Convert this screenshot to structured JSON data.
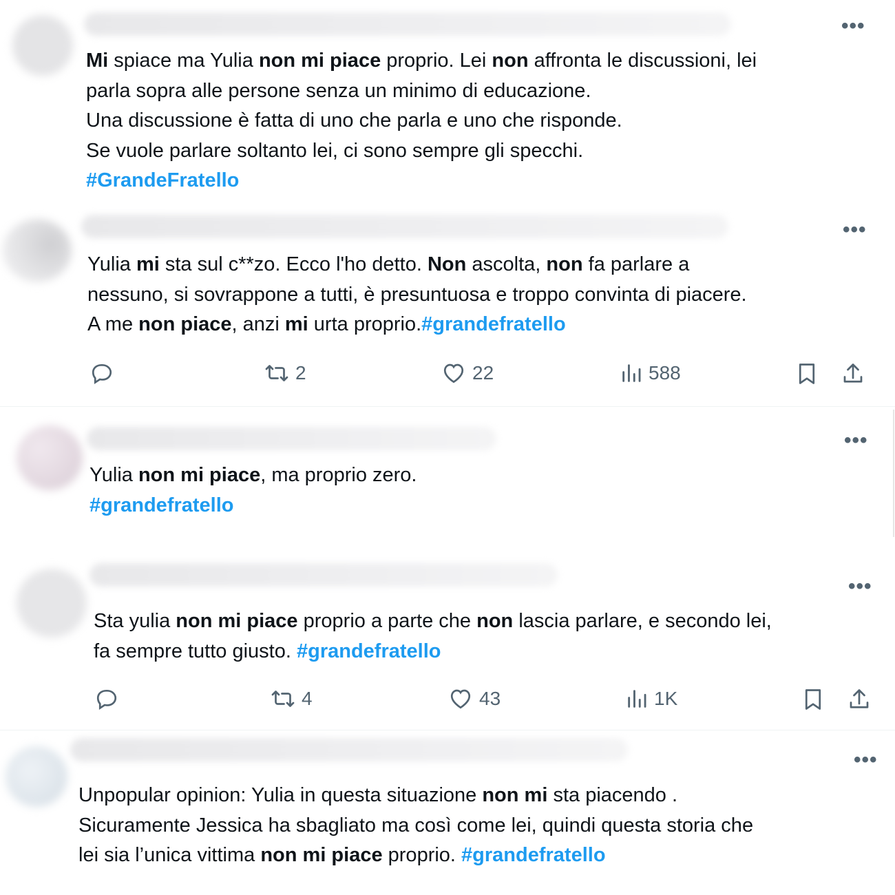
{
  "tweets": [
    {
      "segments": [
        {
          "t": "Mi",
          "s": "b"
        },
        {
          "t": " spiace ma Yulia ",
          "s": ""
        },
        {
          "t": "non mi piace",
          "s": "b"
        },
        {
          "t": " proprio. Lei ",
          "s": ""
        },
        {
          "t": "non",
          "s": "b"
        },
        {
          "t": " affronta le discussioni, lei",
          "s": ""
        },
        {
          "t": "\n",
          "s": "br"
        },
        {
          "t": "parla sopra alle persone senza un minimo di educazione.",
          "s": ""
        },
        {
          "t": "\n",
          "s": "br"
        },
        {
          "t": "Una discussione è fatta di uno che parla e uno che risponde.",
          "s": ""
        },
        {
          "t": "\n",
          "s": "br"
        },
        {
          "t": "Se vuole parlare soltanto lei, ci sono sempre gli specchi.",
          "s": ""
        },
        {
          "t": "\n",
          "s": "br"
        },
        {
          "t": "#GrandeFratello",
          "s": "tag"
        }
      ]
    },
    {
      "segments": [
        {
          "t": "Yulia ",
          "s": ""
        },
        {
          "t": "mi",
          "s": "b"
        },
        {
          "t": " sta sul c**zo. Ecco l'ho detto. ",
          "s": ""
        },
        {
          "t": "Non",
          "s": "b"
        },
        {
          "t": " ascolta, ",
          "s": ""
        },
        {
          "t": "non",
          "s": "b"
        },
        {
          "t": " fa parlare a",
          "s": ""
        },
        {
          "t": "\n",
          "s": "br"
        },
        {
          "t": "nessuno, si sovrappone a tutti, è presuntuosa e troppo convinta di piacere.",
          "s": ""
        },
        {
          "t": "\n",
          "s": "br"
        },
        {
          "t": "A me ",
          "s": ""
        },
        {
          "t": "non piace",
          "s": "b"
        },
        {
          "t": ", anzi ",
          "s": ""
        },
        {
          "t": "mi",
          "s": "b"
        },
        {
          "t": " urta proprio.",
          "s": ""
        },
        {
          "t": "#grandefratello",
          "s": "tag"
        }
      ],
      "actions": {
        "reposts": "2",
        "likes": "22",
        "views": "588"
      }
    },
    {
      "segments": [
        {
          "t": "Yulia ",
          "s": ""
        },
        {
          "t": "non mi piace",
          "s": "b"
        },
        {
          "t": ", ma proprio zero.",
          "s": ""
        },
        {
          "t": "\n",
          "s": "br"
        },
        {
          "t": "#grandefratello",
          "s": "tag"
        }
      ]
    },
    {
      "segments": [
        {
          "t": "Sta yulia ",
          "s": ""
        },
        {
          "t": "non mi piace",
          "s": "b"
        },
        {
          "t": " proprio a parte che ",
          "s": ""
        },
        {
          "t": "non",
          "s": "b"
        },
        {
          "t": " lascia parlare, e secondo lei,",
          "s": ""
        },
        {
          "t": "\n",
          "s": "br"
        },
        {
          "t": "fa sempre tutto giusto.  ",
          "s": ""
        },
        {
          "t": "#grandefratello",
          "s": "tag"
        }
      ],
      "actions": {
        "reposts": "4",
        "likes": "43",
        "views": "1K"
      }
    },
    {
      "segments": [
        {
          "t": "Unpopular opinion: Yulia in questa situazione ",
          "s": ""
        },
        {
          "t": "non mi",
          "s": "b"
        },
        {
          "t": " sta piacendo .",
          "s": ""
        },
        {
          "t": "\n",
          "s": "br"
        },
        {
          "t": "Sicuramente Jessica ha sbagliato ma così come lei, quindi questa storia che",
          "s": ""
        },
        {
          "t": "\n",
          "s": "br"
        },
        {
          "t": "lei sia l’unica vittima ",
          "s": ""
        },
        {
          "t": "non mi piace",
          "s": "b"
        },
        {
          "t": " proprio. ",
          "s": ""
        },
        {
          "t": "#grandefratello",
          "s": "tag"
        }
      ]
    }
  ],
  "icons": {
    "more": "more-horizontal-icon",
    "reply": "reply-icon",
    "repost": "repost-icon",
    "like": "heart-icon",
    "views": "views-icon",
    "bookmark": "bookmark-icon",
    "share": "share-icon"
  },
  "colors": {
    "text": "#0f1419",
    "hashtag": "#1d9bf0",
    "muted": "#536471"
  }
}
